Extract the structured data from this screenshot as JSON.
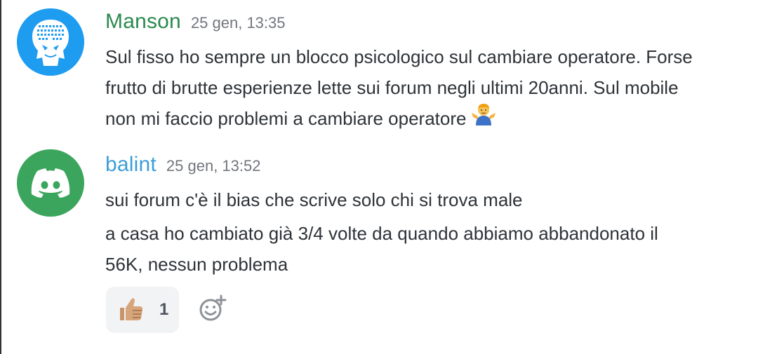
{
  "messages": [
    {
      "author": "Manson",
      "author_color": "#2a8a4e",
      "avatar_icon": "manson-head-avatar",
      "avatar_bg": "#1e9cf0",
      "timestamp": "25 gen, 13:35",
      "lines": [
        "Sul fisso ho sempre un blocco psicologico sul cambiare operatore. Forse",
        "frutto di brutte esperienze lette sui forum negli ultimi 20anni. Sul mobile",
        "non mi faccio problemi a cambiare operatore"
      ],
      "trailing_emoji": "person-shrugging-emoji"
    },
    {
      "author": "balint",
      "author_color": "#3d9ed8",
      "avatar_icon": "discord-logo-avatar",
      "avatar_bg": "#3ba55d",
      "timestamp": "25 gen, 13:52",
      "lines": [
        "sui forum c'è il bias che scrive solo chi si trova male",
        "a casa ho cambiato già 3/4 volte da quando abbiamo abbandonato il",
        "56K, nessun problema"
      ],
      "reactions": [
        {
          "emoji": "thumbs-up-emoji",
          "count": "1"
        }
      ],
      "add_reaction_icon": "add-reaction-icon"
    }
  ]
}
